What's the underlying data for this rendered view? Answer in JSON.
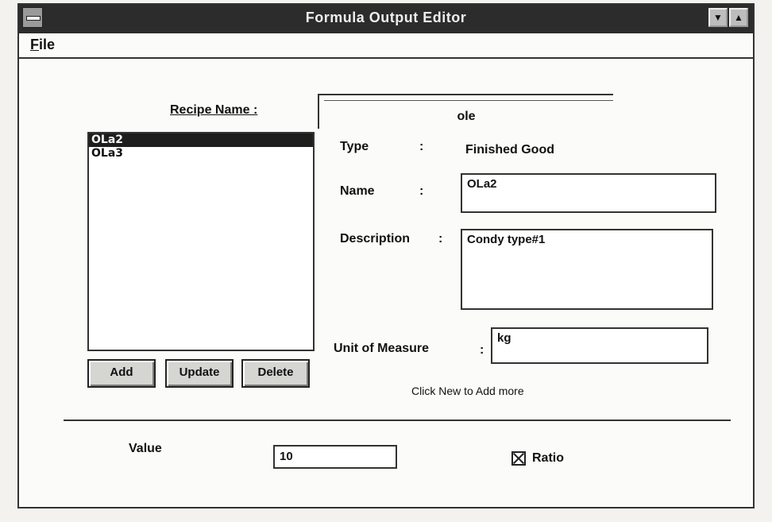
{
  "window": {
    "title": "Formula Output Editor",
    "min_glyph": "▼",
    "max_glyph": "▲"
  },
  "menu": {
    "file_mnemonic": "F",
    "file_rest": "ile"
  },
  "recipe": {
    "label": "Recipe Name :",
    "value": "ole"
  },
  "list": {
    "items": [
      "OLa2",
      "OLa3"
    ],
    "selected_index": 0
  },
  "buttons": {
    "add": "Add",
    "update": "Update",
    "delete": "Delete"
  },
  "details": {
    "type_label": "Type",
    "type_value": "Finished  Good",
    "name_label": "Name",
    "name_value": "OLa2",
    "description_label": "Description",
    "description_value": "Condy type#1",
    "uom_label": "Unit of Measure",
    "uom_value": "kg",
    "colon": ":",
    "hint": "Click New to Add more"
  },
  "footer": {
    "value_label": "Value",
    "value": "10",
    "ratio_label": "Ratio",
    "ratio_checked": true
  }
}
